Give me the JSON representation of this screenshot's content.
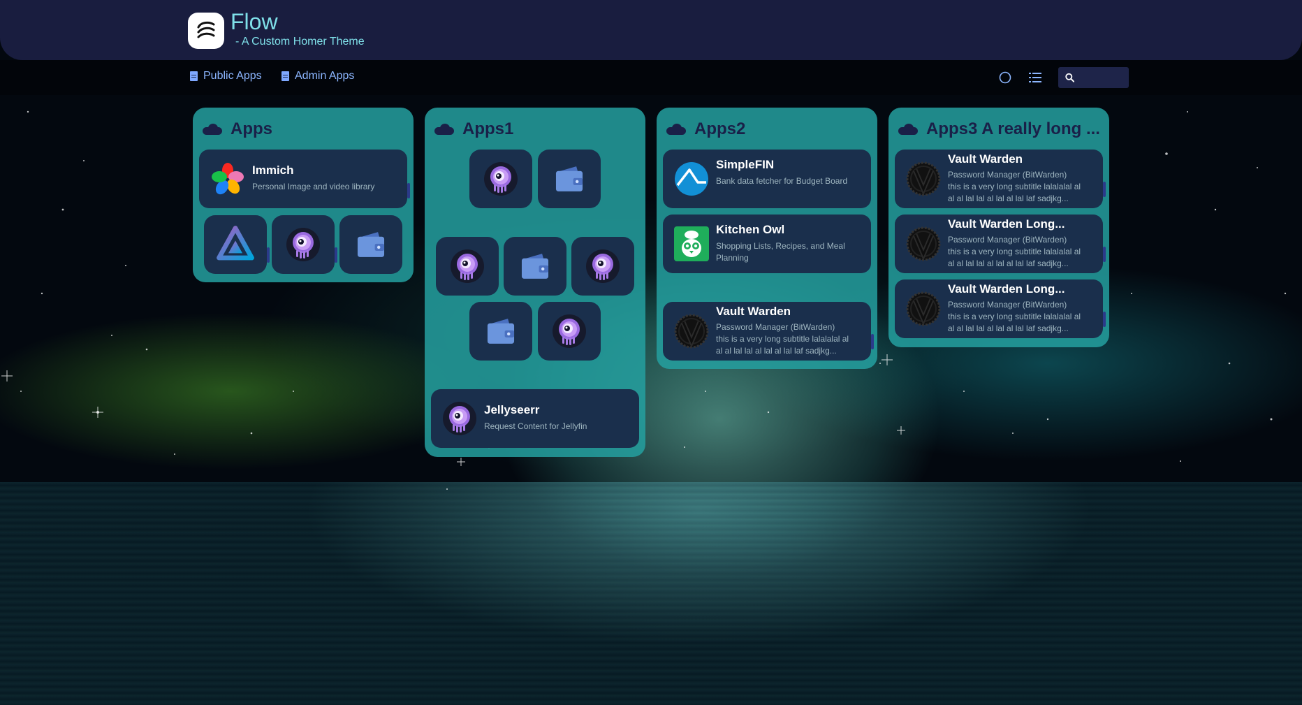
{
  "header": {
    "title": "Flow",
    "subtitle": "- A Custom Homer Theme"
  },
  "navbar": {
    "links": [
      {
        "label": "Public Apps",
        "icon": "document-icon"
      },
      {
        "label": "Admin Apps",
        "icon": "document-icon"
      }
    ],
    "tools": [
      "theme-toggle-icon",
      "list-view-icon"
    ],
    "search": {
      "value": "",
      "placeholder": ""
    }
  },
  "groups": [
    {
      "title": "Apps",
      "cards": [
        {
          "name": "Immich",
          "subtitle": "Personal Image and video library",
          "icon": "immich-icon"
        }
      ],
      "tiles": [
        "jellyfin-icon",
        "jellyseerr-icon",
        "wallet-icon"
      ]
    },
    {
      "title": "Apps1",
      "tiles": [
        "jellyseerr-icon",
        "wallet-icon",
        "jellyseerr-icon",
        "wallet-icon",
        "jellyseerr-icon",
        "wallet-icon",
        "jellyseerr-icon"
      ],
      "cards": [
        {
          "name": "Jellyseerr",
          "subtitle": "Request Content for Jellyfin",
          "icon": "jellyseerr-icon"
        }
      ]
    },
    {
      "title": "Apps2",
      "cards": [
        {
          "name": "SimpleFIN",
          "subtitle": "Bank data fetcher for Budget Board",
          "icon": "simplefin-icon"
        },
        {
          "name": "Kitchen Owl",
          "subtitle": "Shopping Lists, Recipes, and Meal Planning",
          "icon": "kitchenowl-icon"
        },
        {
          "name": "Vault Warden",
          "subtitle": "Password Manager (BitWarden)",
          "subtitle2": "this is a very long subtitle lalalalal al al al lal lal al lal al lal laf sadjkg...",
          "icon": "vaultwarden-icon"
        }
      ]
    },
    {
      "title": "Apps3 A really long ...",
      "cards": [
        {
          "name": "Vault Warden",
          "subtitle": "Password Manager (BitWarden)",
          "subtitle2": "this is a very long subtitle lalalalal al al al lal lal al lal al lal laf sadjkg...",
          "icon": "vaultwarden-icon"
        },
        {
          "name": "Vault Warden Long...",
          "subtitle": "Password Manager (BitWarden)",
          "subtitle2": "this is a very long subtitle lalalalal al al al lal lal al lal al lal laf sadjkg...",
          "icon": "vaultwarden-icon"
        },
        {
          "name": "Vault Warden Long...",
          "subtitle": "Password Manager (BitWarden)",
          "subtitle2": "this is a very long subtitle lalalalal al al al lal lal al lal al lal laf sadjkg...",
          "icon": "vaultwarden-icon"
        }
      ]
    }
  ],
  "colors": {
    "accent": "#7fe0e9",
    "group_bg": "#24a0a0",
    "card_bg": "#1a2f4c",
    "header_bg": "#191d3f"
  }
}
